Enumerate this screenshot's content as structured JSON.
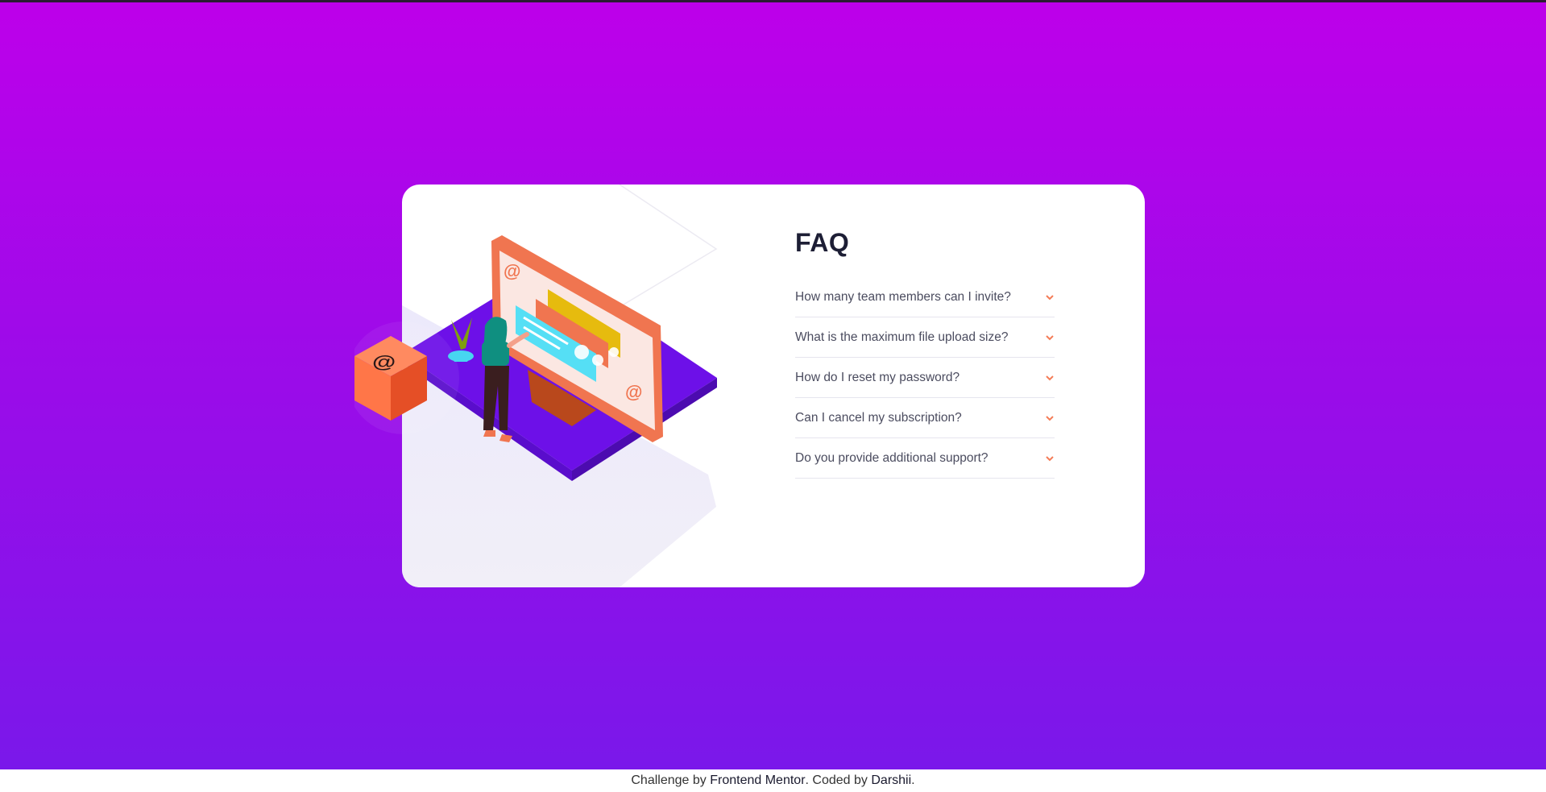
{
  "faq": {
    "title": "FAQ",
    "items": [
      {
        "question": "How many team members can I invite?"
      },
      {
        "question": "What is the maximum file upload size?"
      },
      {
        "question": "How do I reset my password?"
      },
      {
        "question": "Can I cancel my subscription?"
      },
      {
        "question": "Do you provide additional support?"
      }
    ]
  },
  "footer": {
    "prefix": "Challenge by ",
    "link1": "Frontend Mentor",
    "middle": ". Coded by ",
    "link2": "Darshii",
    "suffix": "."
  },
  "colors": {
    "accent": "#f47c57",
    "card": "#ffffff",
    "gradient_top": "#bd00ea",
    "gradient_bottom": "#7a18ea",
    "title": "#1d1e35",
    "question": "#4b4c5f"
  }
}
